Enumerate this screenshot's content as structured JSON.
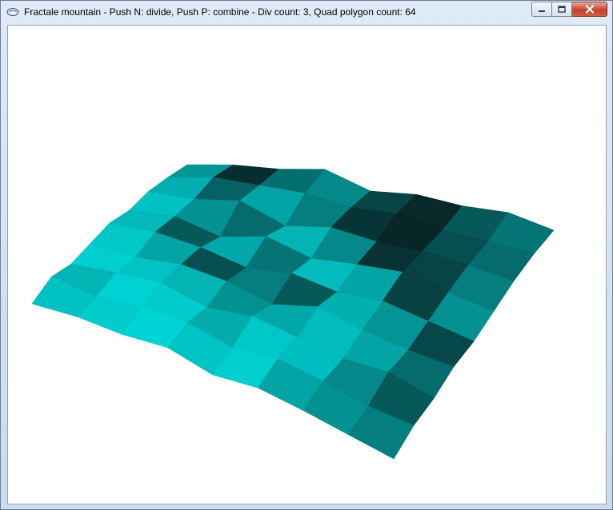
{
  "window": {
    "title": "Fractale mountain - Push N: divide, Push P: combine - Div count: 3, Quad polygon count: 64",
    "icon": "app-window-icon",
    "controls": {
      "minimize_icon": "minimize-icon",
      "maximize_icon": "maximize-icon",
      "close_icon": "close-icon"
    }
  },
  "viewport": {
    "background": "#ffffff",
    "surface_color": "#00e0e0",
    "shadow_color": "#0a1a1c",
    "grid": {
      "rows": 8,
      "cols": 8
    }
  }
}
